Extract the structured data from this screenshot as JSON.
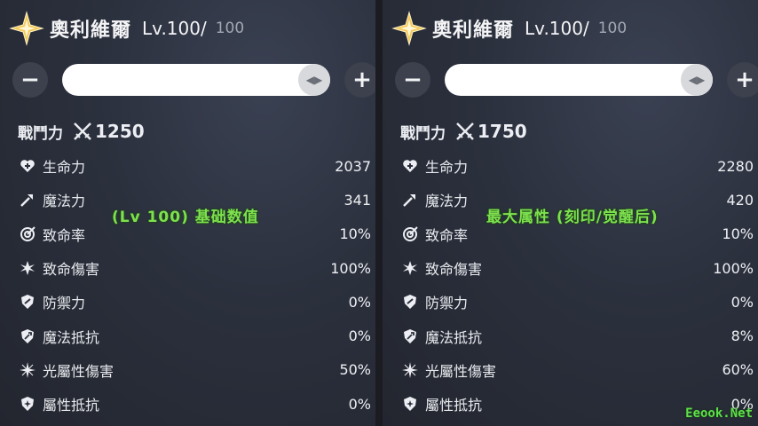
{
  "panels": [
    {
      "character_name": "奧利維爾",
      "level": "Lv.100/",
      "level_max": "100",
      "slider_value": 1.0,
      "combat_power_label": "戰鬥力",
      "combat_power": "1250",
      "stats": [
        {
          "icon": "heart-plus-icon",
          "label": "生命力",
          "value": "2037"
        },
        {
          "icon": "wand-icon",
          "label": "魔法力",
          "value": "341"
        },
        {
          "icon": "crit-target-icon",
          "label": "致命率",
          "value": "10%"
        },
        {
          "icon": "crit-burst-icon",
          "label": "致命傷害",
          "value": "100%"
        },
        {
          "icon": "shield-icon",
          "label": "防禦力",
          "value": "0%"
        },
        {
          "icon": "magic-shield-icon",
          "label": "魔法抵抗",
          "value": "0%"
        },
        {
          "icon": "light-sparkle-icon",
          "label": "光屬性傷害",
          "value": "50%"
        },
        {
          "icon": "element-shield-icon",
          "label": "屬性抵抗",
          "value": "0%"
        }
      ],
      "overlay_caption": "(Lv 100) 基础数值"
    },
    {
      "character_name": "奧利維爾",
      "level": "Lv.100/",
      "level_max": "100",
      "slider_value": 1.0,
      "combat_power_label": "戰鬥力",
      "combat_power": "1750",
      "stats": [
        {
          "icon": "heart-plus-icon",
          "label": "生命力",
          "value": "2280"
        },
        {
          "icon": "wand-icon",
          "label": "魔法力",
          "value": "420"
        },
        {
          "icon": "crit-target-icon",
          "label": "致命率",
          "value": "10%"
        },
        {
          "icon": "crit-burst-icon",
          "label": "致命傷害",
          "value": "100%"
        },
        {
          "icon": "shield-icon",
          "label": "防禦力",
          "value": "0%"
        },
        {
          "icon": "magic-shield-icon",
          "label": "魔法抵抗",
          "value": "8%"
        },
        {
          "icon": "light-sparkle-icon",
          "label": "光屬性傷害",
          "value": "60%"
        },
        {
          "icon": "element-shield-icon",
          "label": "屬性抵抗",
          "value": "0%"
        }
      ],
      "overlay_caption": "最大属性 (刻印/觉醒后)"
    }
  ],
  "buttons": {
    "minus": "−",
    "plus": "+"
  },
  "watermark": "Eeook.Net",
  "colors": {
    "overlay_text": "#7ee04f",
    "star_gold": "#f3c95a",
    "background": "#2b303d"
  }
}
